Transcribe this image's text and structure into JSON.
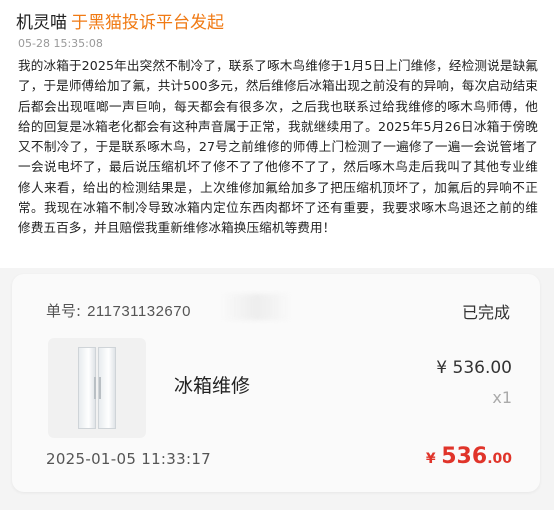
{
  "post": {
    "author": "机灵喵",
    "source": "于黑猫投诉平台发起",
    "timestamp": "05-28 15:35:08",
    "complaint_text": "我的冰箱于2025年出突然不制冷了，联系了啄木鸟维修于1月5日上门维修，经检测说是缺氟了，于是师傅给加了氟，共计500多元，然后维修后冰箱出现之前没有的异响，每次启动结束后都会出现哐啷一声巨响，每天都会有很多次，之后我也联系过给我维修的啄木鸟师傅，他给的回复是冰箱老化都会有这种声音属于正常，我就继续用了。2025年5月26日冰箱于傍晚又不制冷了，于是联系啄木鸟，27号之前维修的师傅上门检测了一遍修了一遍一会说管堵了一会说电坏了，最后说压缩机坏了修不了了他修不了了，然后啄木鸟走后我叫了其他专业维修人来看，给出的检测结果是，上次维修加氟给加多了把压缩机顶坏了，加氟后的异响不正常。我现在冰箱不制冷导致冰箱内定位东西肉都坏了还有重要，我要求啄木鸟退还之前的维修费五百多，并且赔偿我重新维修冰箱换压缩机等费用！"
  },
  "order": {
    "order_label": "单号:",
    "order_number": "211731132670",
    "status": "已完成",
    "product_name": "冰箱维修",
    "product_icon": "refrigerator-icon",
    "unit_price": "¥ 536.00",
    "quantity": "x1",
    "date": "2025-01-05 11:33:17",
    "total_currency": "¥",
    "total_integer": "536",
    "total_decimal": ".00",
    "total_color": "#e0342a"
  }
}
